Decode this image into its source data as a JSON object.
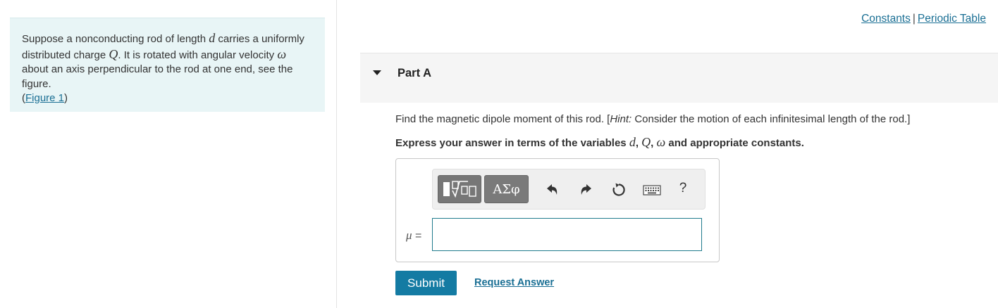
{
  "problem": {
    "segments": [
      {
        "t": "Suppose a nonconducting rod of length "
      },
      {
        "m": "d"
      },
      {
        "t": " carries a uniformly distributed charge "
      },
      {
        "m": "Q"
      },
      {
        "t": ". It is rotated with angular velocity "
      },
      {
        "m": "ω"
      },
      {
        "t": " about an axis perpendicular to the rod at one end, see the figure."
      }
    ],
    "figure_open": "(",
    "figure_link": "Figure 1",
    "figure_close": ")"
  },
  "top_links": {
    "constants": "Constants",
    "separator": "|",
    "periodic_table": "Periodic Table"
  },
  "part": {
    "title": "Part A"
  },
  "question": {
    "main": "Find the magnetic dipole moment of this rod. [",
    "hint_label": "Hint:",
    "hint_text": " Consider the motion of each infinitesimal length of the rod.]"
  },
  "instruction": {
    "prefix": "Express your answer in terms of the variables ",
    "var1": "d",
    "comma1": ", ",
    "var2": "Q",
    "comma2": ", ",
    "var3": "ω",
    "suffix": " and appropriate constants."
  },
  "toolbar": {
    "greek_label": "ΑΣφ",
    "help_label": "?",
    "icons": [
      "templates-icon",
      "undo-icon",
      "redo-icon",
      "reset-icon",
      "keyboard-icon",
      "help-icon"
    ]
  },
  "answer": {
    "variable": "μ",
    "equals": " =",
    "value": ""
  },
  "actions": {
    "submit_label": "Submit",
    "request_answer_label": "Request Answer"
  },
  "colors": {
    "problem_bg": "#e8f5f6",
    "link": "#1a6f94",
    "submit_bg": "#147ba3",
    "input_border": "#1f7b8c"
  }
}
